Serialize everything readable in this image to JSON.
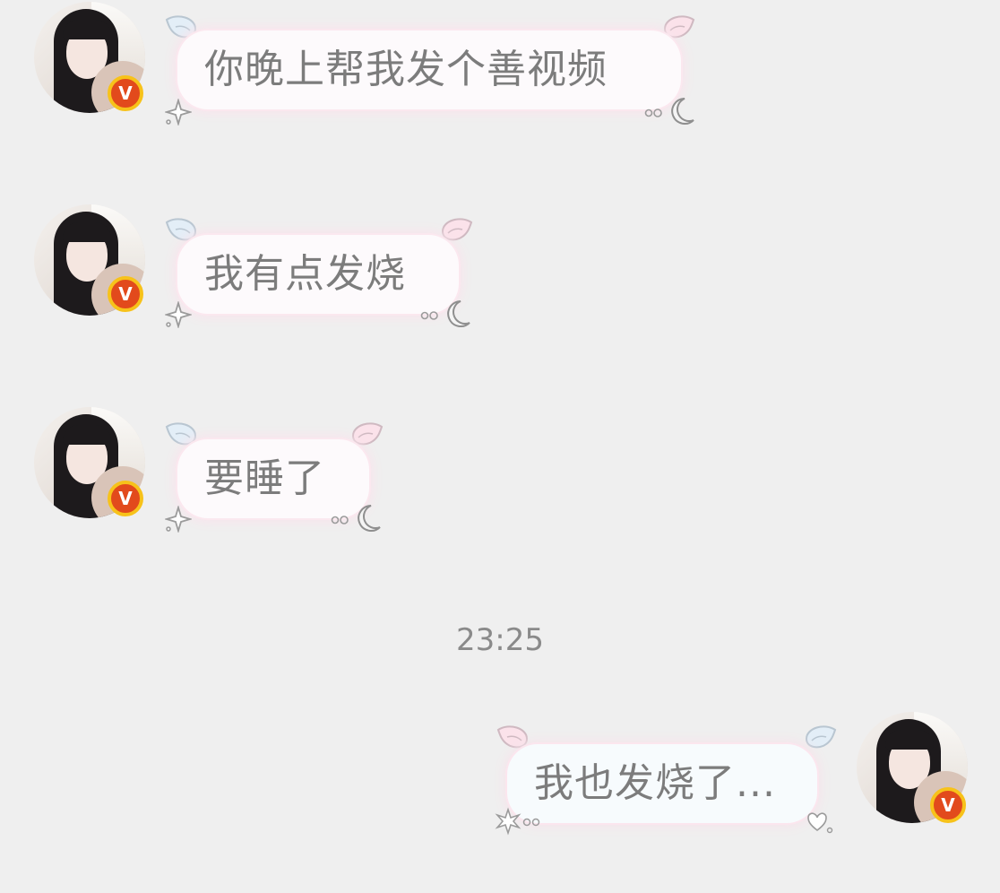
{
  "chat": {
    "messages": [
      {
        "side": "left",
        "text": "你晚上帮我发个善视频",
        "has_verified_badge": true
      },
      {
        "side": "left",
        "text": "我有点发烧",
        "has_verified_badge": true
      },
      {
        "side": "left",
        "text": "要睡了",
        "has_verified_badge": true
      },
      {
        "side": "right",
        "text": "我也发烧了...",
        "has_verified_badge": true
      }
    ],
    "timestamp": "23:25",
    "badge_label": "V"
  },
  "colors": {
    "background": "#efefef",
    "bubble_text": "#7c7c7c",
    "badge_red": "#e24a1c",
    "badge_gold": "#f7c21a",
    "wing_blue": "#dceaf5",
    "wing_pink": "#f8dbe3"
  },
  "icons": [
    "wing-blue-icon",
    "wing-pink-icon",
    "sparkle-icon",
    "moon-icon",
    "heart-icon",
    "verified-badge-icon"
  ]
}
